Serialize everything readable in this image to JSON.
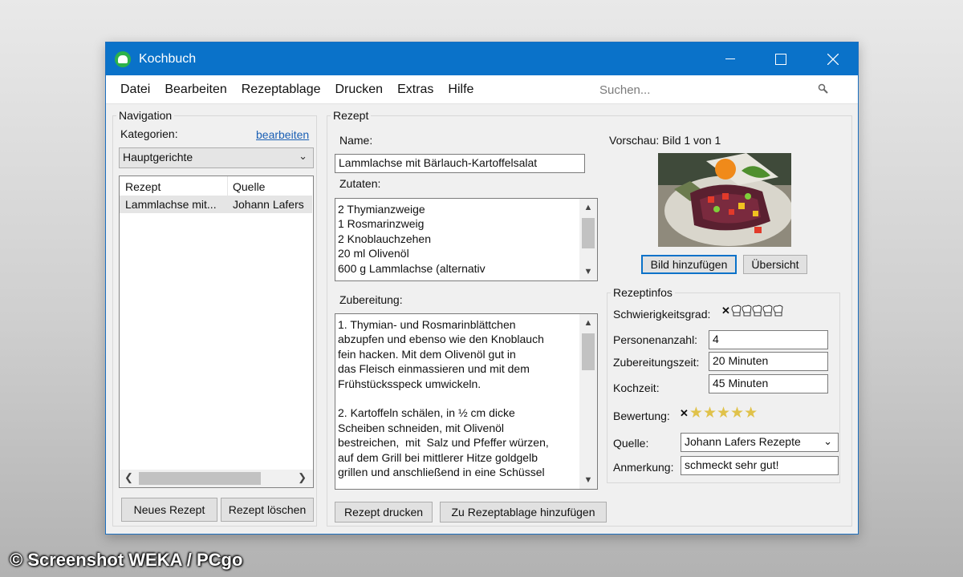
{
  "window": {
    "title": "Kochbuch"
  },
  "menu": {
    "items": [
      "Datei",
      "Bearbeiten",
      "Rezeptablage",
      "Drucken",
      "Extras",
      "Hilfe"
    ],
    "search_placeholder": "Suchen..."
  },
  "navigation": {
    "group_title": "Navigation",
    "categories_label": "Kategorien:",
    "edit_link": "bearbeiten",
    "category_selected": "Hauptgerichte",
    "columns": [
      "Rezept",
      "Quelle"
    ],
    "rows": [
      {
        "recipe": "Lammlachse mit...",
        "source": "Johann Lafers"
      }
    ],
    "new_button": "Neues Rezept",
    "delete_button": "Rezept löschen"
  },
  "recipe": {
    "group_title": "Rezept",
    "name_label": "Name:",
    "name_value": "Lammlachse mit Bärlauch-Kartoffelsalat",
    "ingredients_label": "Zutaten:",
    "ingredients_text": "2 Thymianzweige\n1 Rosmarinzweig\n2 Knoblauchzehen\n20 ml Olivenöl\n600 g Lammlachse (alternativ",
    "prep_label": "Zubereitung:",
    "prep_text": "1. Thymian- und Rosmarinblättchen\nabzupfen und ebenso wie den Knoblauch\nfein hacken. Mit dem Olivenöl gut in\ndas Fleisch einmassieren und mit dem\nFrühstücksspeck umwickeln.\n\n2. Kartoffeln schälen, in ½ cm dicke\nScheiben schneiden, mit Olivenöl\nbestreichen,  mit  Salz und Pfeffer würzen,\nauf dem Grill bei mittlerer Hitze goldgelb\ngrillen und anschließend in eine Schüssel",
    "print_button": "Rezept drucken",
    "add_to_storage_button": "Zu Rezeptablage hinzufügen"
  },
  "preview": {
    "label": "Vorschau: Bild 1 von 1",
    "add_image_button": "Bild hinzufügen",
    "overview_button": "Übersicht"
  },
  "info": {
    "group_title": "Rezeptinfos",
    "difficulty_label": "Schwierigkeitsgrad:",
    "difficulty_level": 0,
    "difficulty_max": 5,
    "persons_label": "Personenanzahl:",
    "persons_value": "4",
    "prep_time_label": "Zubereitungszeit:",
    "prep_time_value": "20 Minuten",
    "cook_time_label": "Kochzeit:",
    "cook_time_value": "45 Minuten",
    "rating_label": "Bewertung:",
    "rating_value": 5,
    "rating_max": 5,
    "source_label": "Quelle:",
    "source_value": "Johann Lafers Rezepte",
    "note_label": "Anmerkung:",
    "note_value": "schmeckt sehr gut!"
  },
  "watermark": "© Screenshot WEKA / PCgo",
  "colors": {
    "titlebar": "#0a72c9",
    "link": "#1a5fb4",
    "star": "#e0c24a"
  }
}
